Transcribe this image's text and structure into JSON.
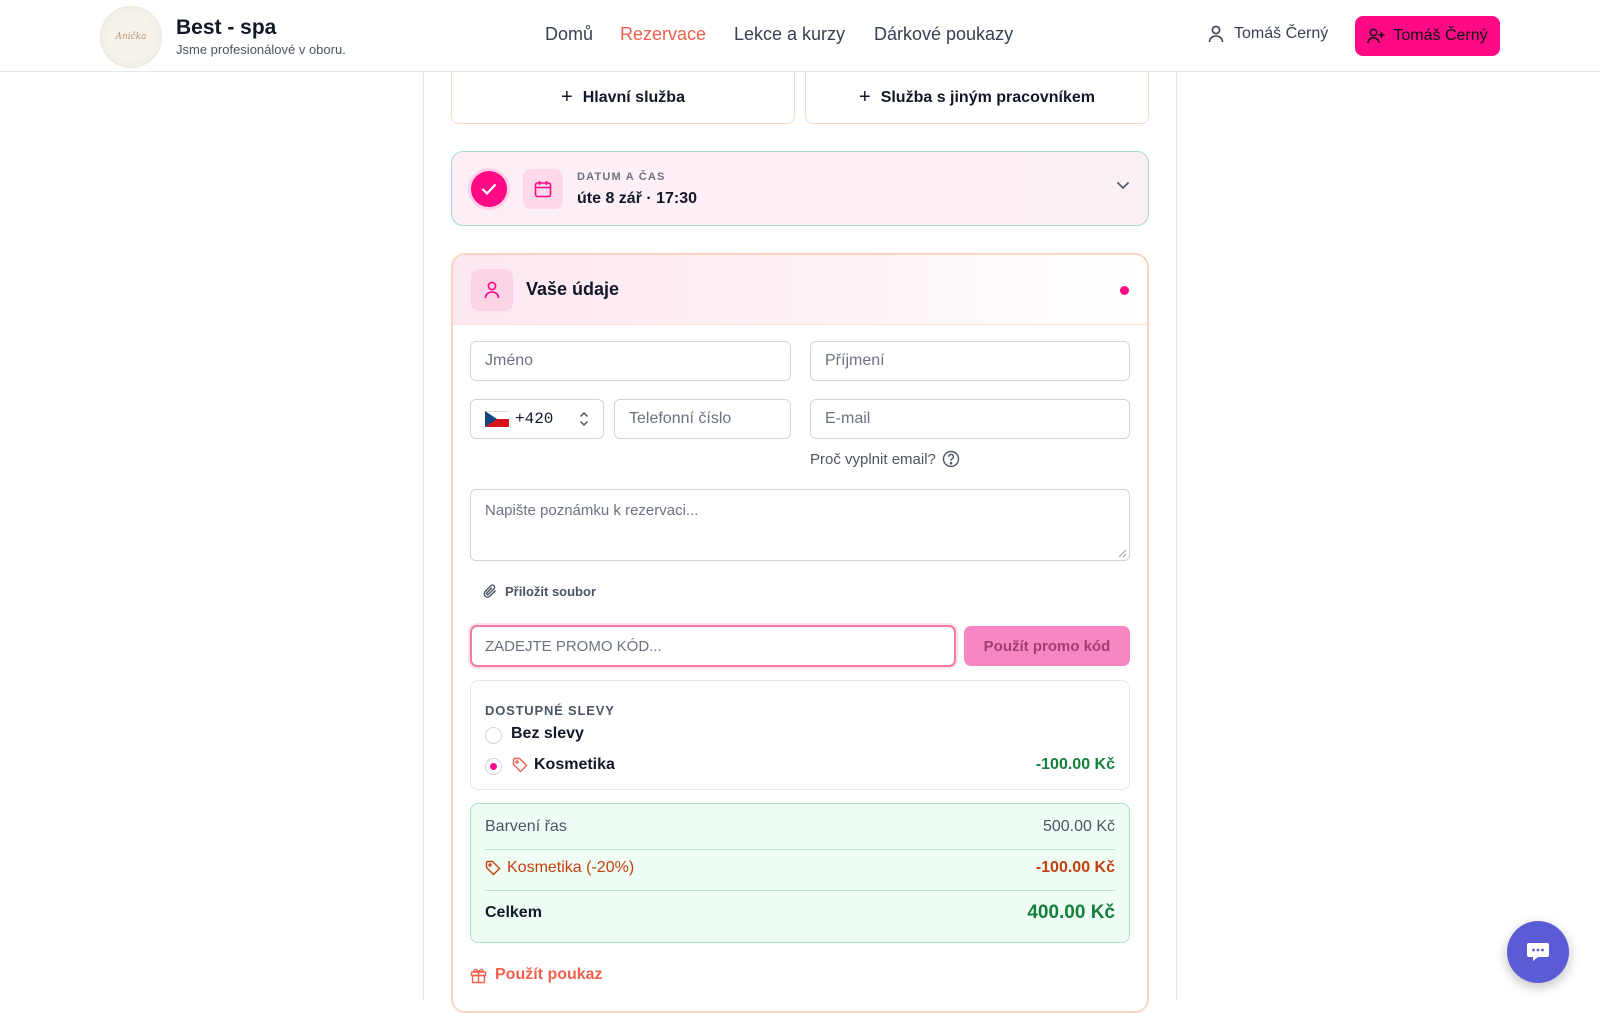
{
  "brand": {
    "title": "Best - spa",
    "subtitle": "Jsme profesionálové v oboru.",
    "logo_text": "Anička"
  },
  "nav": {
    "items": [
      {
        "label": "Domů"
      },
      {
        "label": "Rezervace"
      },
      {
        "label": "Lekce a kurzy"
      },
      {
        "label": "Dárkové poukazy"
      }
    ]
  },
  "user": {
    "name": "Tomáš Černý",
    "button_label": "Tomáš Černý"
  },
  "services": {
    "main_label": "Hlavní služba",
    "other_label": "Služba s jiným pracovníkem"
  },
  "datetime": {
    "label": "DATUM A ČAS",
    "value": "úte 8 zář · 17:30"
  },
  "details": {
    "title": "Vaše údaje",
    "first_name_placeholder": "Jméno",
    "last_name_placeholder": "Příjmení",
    "phone_code": "+420",
    "phone_placeholder": "Telefonní číslo",
    "email_placeholder": "E-mail",
    "why_email": "Proč vyplnit email?",
    "note_placeholder": "Napište poznámku k rezervaci...",
    "attach_label": "Přiložit soubor",
    "promo_placeholder": "ZADEJTE PROMO KÓD...",
    "promo_button": "Použít promo kód"
  },
  "discounts": {
    "label": "DOSTUPNÉ SLEVY",
    "options": [
      {
        "label": "Bez slevy",
        "amount": "",
        "selected": false
      },
      {
        "label": "Kosmetika",
        "amount": "-100.00 Kč",
        "selected": true
      }
    ]
  },
  "summary": {
    "item_label": "Barvení řas",
    "item_price": "500.00 Kč",
    "discount_label": "Kosmetika (-20%)",
    "discount_amount": "-100.00 Kč",
    "total_label": "Celkem",
    "total_amount": "400.00 Kč"
  },
  "voucher_label": "Použít poukaz",
  "colors": {
    "accent": "#ff0a86",
    "nav_active": "#f0604d",
    "success": "#15803d",
    "chat": "#5b5bd6"
  }
}
